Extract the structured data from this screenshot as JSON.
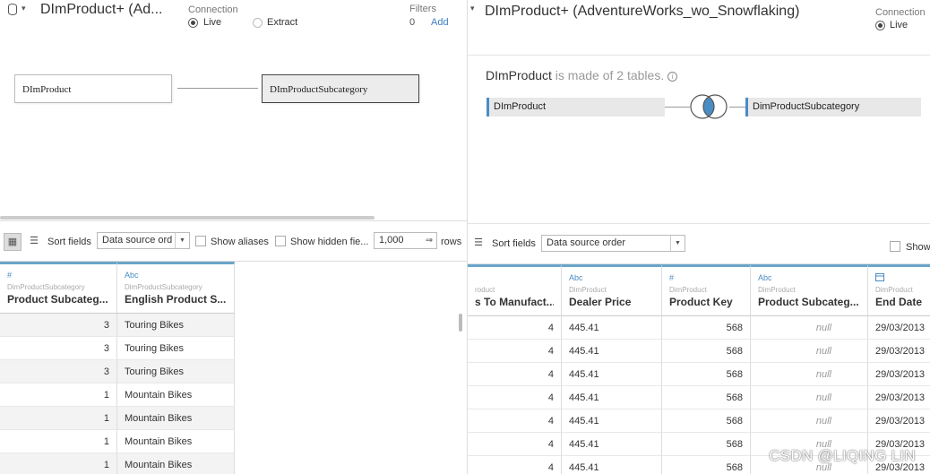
{
  "left": {
    "title": "DImProduct+ (Ad...",
    "connection_label": "Connection",
    "conn_live": "Live",
    "conn_extract": "Extract",
    "filters_label": "Filters",
    "filters_count": "0",
    "filters_add": "Add",
    "canvas": {
      "table1": "DImProduct",
      "table2": "DImProductSubcategory"
    },
    "toolbar": {
      "sort_label": "Sort fields",
      "sort_value": "Data source ord",
      "show_aliases": "Show aliases",
      "show_hidden": "Show hidden fie...",
      "rows_value": "1,000",
      "rows_label": "rows"
    },
    "columns": [
      {
        "type": "#",
        "source": "DimProductSubcategory",
        "name": "Product Subcateg...",
        "values": [
          "3",
          "3",
          "3",
          "1",
          "1",
          "1",
          "1"
        ]
      },
      {
        "type": "Abc",
        "source": "DimProductSubcategory",
        "name": "English Product S...",
        "values": [
          "Touring Bikes",
          "Touring Bikes",
          "Touring Bikes",
          "Mountain Bikes",
          "Mountain Bikes",
          "Mountain Bikes",
          "Mountain Bikes"
        ]
      }
    ]
  },
  "right": {
    "title": "DImProduct+ (AdventureWorks_wo_Snowflaking)",
    "connection_label": "Connection",
    "conn_live": "Live",
    "made_of_table": "DImProduct",
    "made_of_rest": " is made of 2 tables.",
    "canvas": {
      "table1": "DImProduct",
      "table2": "DimProductSubcategory"
    },
    "toolbar": {
      "sort_label": "Sort fields",
      "sort_value": "Data source order",
      "show_label": "Show"
    },
    "columns": [
      {
        "type": "",
        "source": "roduct",
        "name": "s To Manufact...",
        "values": [
          "4",
          "4",
          "4",
          "4",
          "4",
          "4",
          "4"
        ]
      },
      {
        "type": "Abc",
        "source": "DimProduct",
        "name": "Dealer Price",
        "values": [
          "445.41",
          "445.41",
          "445.41",
          "445.41",
          "445.41",
          "445.41",
          "445.41"
        ]
      },
      {
        "type": "#",
        "source": "DimProduct",
        "name": "Product Key",
        "values": [
          "568",
          "568",
          "568",
          "568",
          "568",
          "568",
          "568"
        ]
      },
      {
        "type": "Abc",
        "source": "DimProduct",
        "name": "Product Subcateg...",
        "values": [
          "null",
          "null",
          "null",
          "null",
          "null",
          "null",
          "null"
        ]
      },
      {
        "type": "calendar-icon",
        "source": "DimProduct",
        "name": "End Date",
        "values": [
          "29/03/2013",
          "29/03/2013",
          "29/03/2013",
          "29/03/2013",
          "29/03/2013",
          "29/03/2013",
          "29/03/2013"
        ]
      }
    ]
  },
  "watermark": "CSDN @LIQING LIN",
  "colors": {
    "accent": "#4a8cc4",
    "header_bar": "#6aa5c9",
    "link": "#3a7fc4"
  }
}
